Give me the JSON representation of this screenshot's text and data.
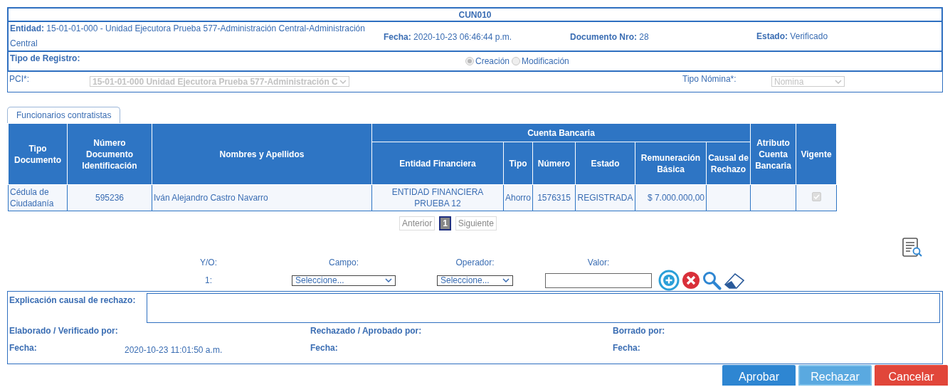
{
  "form_code": "CUN010",
  "header": {
    "entidad": {
      "label": "Entidad:",
      "value": "15-01-01-000 - Unidad Ejecutora Prueba 577-Administración Central-Administración Central"
    },
    "fecha": {
      "label": "Fecha:",
      "value": "2020-10-23 06:46:44 p.m."
    },
    "documento": {
      "label": "Documento Nro:",
      "value": "28"
    },
    "estado": {
      "label": "Estado:",
      "value": "Verificado"
    }
  },
  "tipo_registro": {
    "label": "Tipo de Registro:",
    "options": [
      {
        "label": "Creación",
        "selected": true
      },
      {
        "label": "Modificación",
        "selected": false
      }
    ]
  },
  "pci": {
    "label": "PCI*:",
    "value": "15-01-01-000 Unidad Ejecutora Prueba 577-Administración C"
  },
  "tipo_nomina": {
    "label": "Tipo Nómina*:",
    "value": "Nomina"
  },
  "tabs": [
    {
      "label": "Funcionarios contratistas",
      "selected": true
    }
  ],
  "table": {
    "columns": [
      {
        "label": "Tipo Documento"
      },
      {
        "label": "Número Documento Identificación"
      },
      {
        "label": "Nombres y Apellidos"
      },
      {
        "label": "Cuenta Bancaria",
        "children": [
          "Entidad Financiera",
          "Tipo",
          "Número",
          "Estado",
          "Remuneración Básica",
          "Causal de Rechazo"
        ]
      },
      {
        "label": "Atributo Cuenta Bancaria"
      },
      {
        "label": "Vigente"
      }
    ],
    "rows": [
      {
        "tipo_documento": "Cédula de Ciudadanía",
        "numero_documento": "595236",
        "nombres": "Iván Alejandro Castro Navarro",
        "entidad_financiera": "ENTIDAD FINANCIERA PRUEBA 12",
        "tipo": "Ahorro",
        "numero": "1576315",
        "estado": "REGISTRADA",
        "remuneracion": "$ 7.000.000,00",
        "vigente": true
      }
    ]
  },
  "pagination": {
    "previous": "Anterior",
    "pages": [
      {
        "label": "1",
        "selected": true
      }
    ],
    "next": "Siguiente"
  },
  "filter": {
    "headers": [
      "Y/O:",
      "Campo:",
      "Operador:",
      "Valor:"
    ],
    "row_index": "1:",
    "campo": "Seleccione...",
    "operador": "Seleccione..."
  },
  "explicacion": {
    "label": "Explicación causal de rechazo:"
  },
  "signatures": [
    {
      "label": "Elaborado / Verificado por:",
      "fecha_label": "Fecha:",
      "fecha": "2020-10-23 11:01:50 a.m."
    },
    {
      "label": "Rechazado / Aprobado por:",
      "fecha_label": "Fecha:"
    },
    {
      "label": "Borrado por:",
      "fecha_label": "Fecha:"
    }
  ],
  "buttons": [
    {
      "label": "Aprobar",
      "kind": "primary"
    },
    {
      "label": "Rechazar",
      "kind": "secondary"
    },
    {
      "label": "Cancelar",
      "kind": "danger"
    }
  ]
}
